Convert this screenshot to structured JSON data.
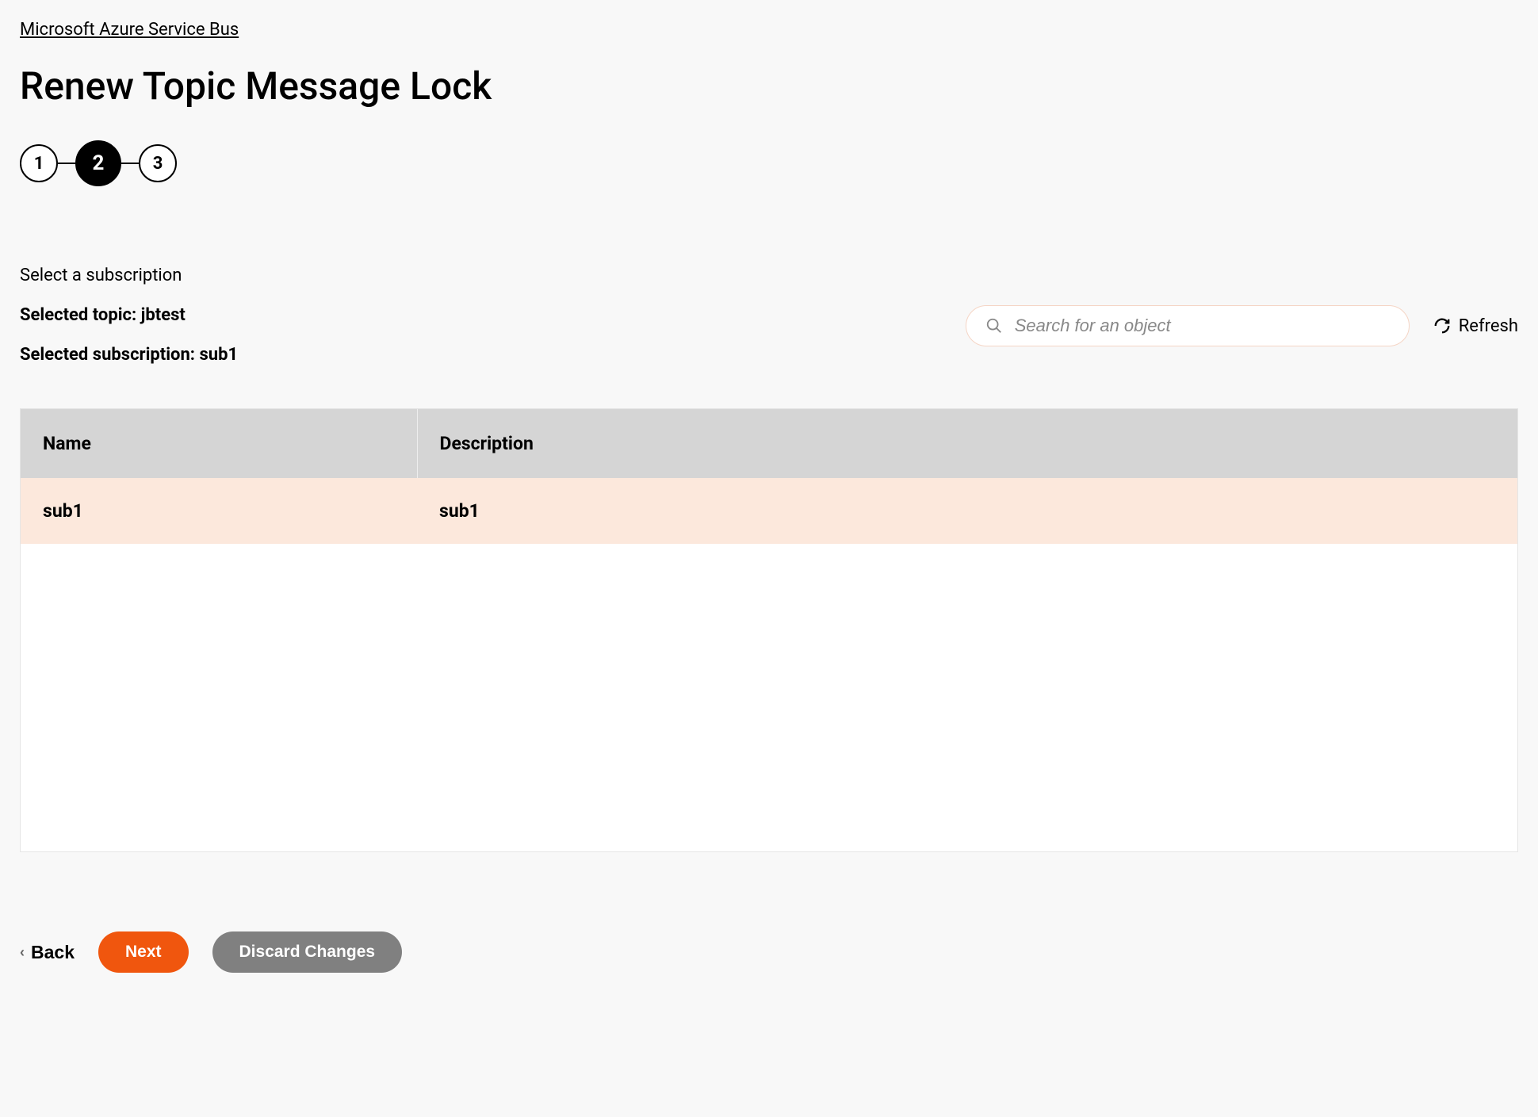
{
  "breadcrumb": {
    "label": "Microsoft Azure Service Bus"
  },
  "page": {
    "title": "Renew Topic Message Lock"
  },
  "stepper": {
    "steps": [
      "1",
      "2",
      "3"
    ],
    "active_index": 1
  },
  "section": {
    "label": "Select a subscription",
    "selected_topic_label": "Selected topic: jbtest",
    "selected_subscription_label": "Selected subscription: sub1"
  },
  "search": {
    "placeholder": "Search for an object"
  },
  "refresh": {
    "label": "Refresh"
  },
  "table": {
    "headers": {
      "name": "Name",
      "description": "Description"
    },
    "rows": [
      {
        "name": "sub1",
        "description": "sub1",
        "selected": true
      }
    ]
  },
  "footer": {
    "back_label": "Back",
    "next_label": "Next",
    "discard_label": "Discard Changes"
  }
}
